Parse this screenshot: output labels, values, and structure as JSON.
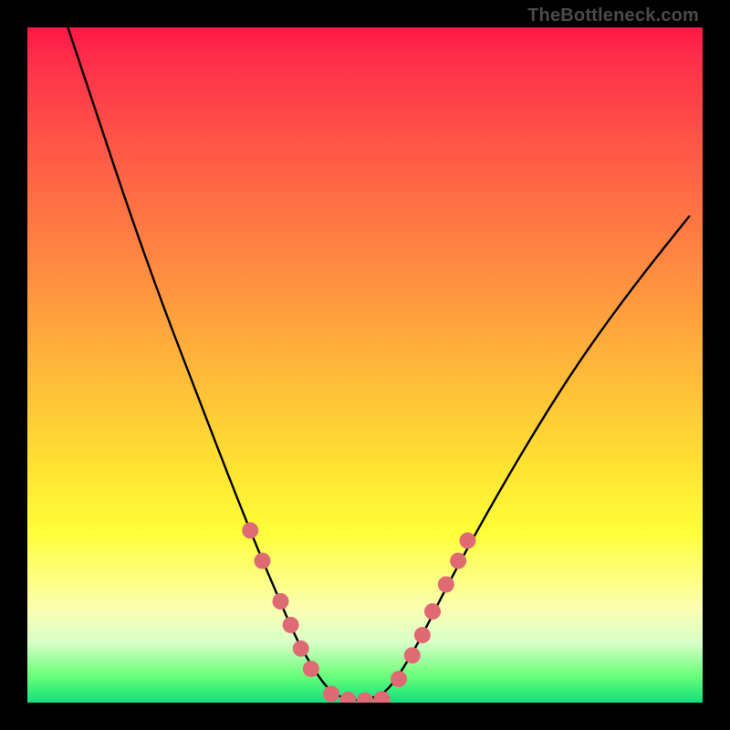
{
  "watermark": "TheBottleneck.com",
  "chart_data": {
    "type": "line",
    "title": "",
    "xlabel": "",
    "ylabel": "",
    "xlim": [
      0,
      100
    ],
    "ylim": [
      0,
      100
    ],
    "series": [
      {
        "name": "bottleneck-curve",
        "x": [
          6,
          10,
          15,
          20,
          25,
          30,
          34,
          37,
          40,
          43,
          45,
          47,
          49,
          51,
          53,
          55,
          58,
          62,
          68,
          75,
          82,
          90,
          98
        ],
        "y": [
          100,
          88,
          73,
          59,
          46,
          33,
          23,
          16,
          9,
          4,
          1.5,
          0.6,
          0.3,
          0.6,
          1.5,
          4,
          9,
          17,
          28,
          40,
          51,
          62,
          72
        ]
      }
    ],
    "markers": {
      "name": "highlight-dots",
      "color": "#e06a74",
      "points": [
        {
          "x": 33.0,
          "y": 25.5
        },
        {
          "x": 34.8,
          "y": 21.0
        },
        {
          "x": 37.5,
          "y": 15.0
        },
        {
          "x": 39.0,
          "y": 11.5
        },
        {
          "x": 40.5,
          "y": 8.0
        },
        {
          "x": 42.0,
          "y": 5.0
        },
        {
          "x": 45.0,
          "y": 1.3
        },
        {
          "x": 47.5,
          "y": 0.4
        },
        {
          "x": 50.0,
          "y": 0.3
        },
        {
          "x": 52.5,
          "y": 0.5
        },
        {
          "x": 55.0,
          "y": 3.5
        },
        {
          "x": 57.0,
          "y": 7.0
        },
        {
          "x": 58.5,
          "y": 10.0
        },
        {
          "x": 60.0,
          "y": 13.5
        },
        {
          "x": 62.0,
          "y": 17.5
        },
        {
          "x": 63.8,
          "y": 21.0
        },
        {
          "x": 65.2,
          "y": 24.0
        }
      ]
    },
    "gradient_stops": [
      {
        "pos": 0.0,
        "color": "#ff1846"
      },
      {
        "pos": 0.34,
        "color": "#ff8642"
      },
      {
        "pos": 0.66,
        "color": "#ffe532"
      },
      {
        "pos": 0.86,
        "color": "#fcffb0"
      },
      {
        "pos": 0.99,
        "color": "#26e87a"
      }
    ]
  }
}
